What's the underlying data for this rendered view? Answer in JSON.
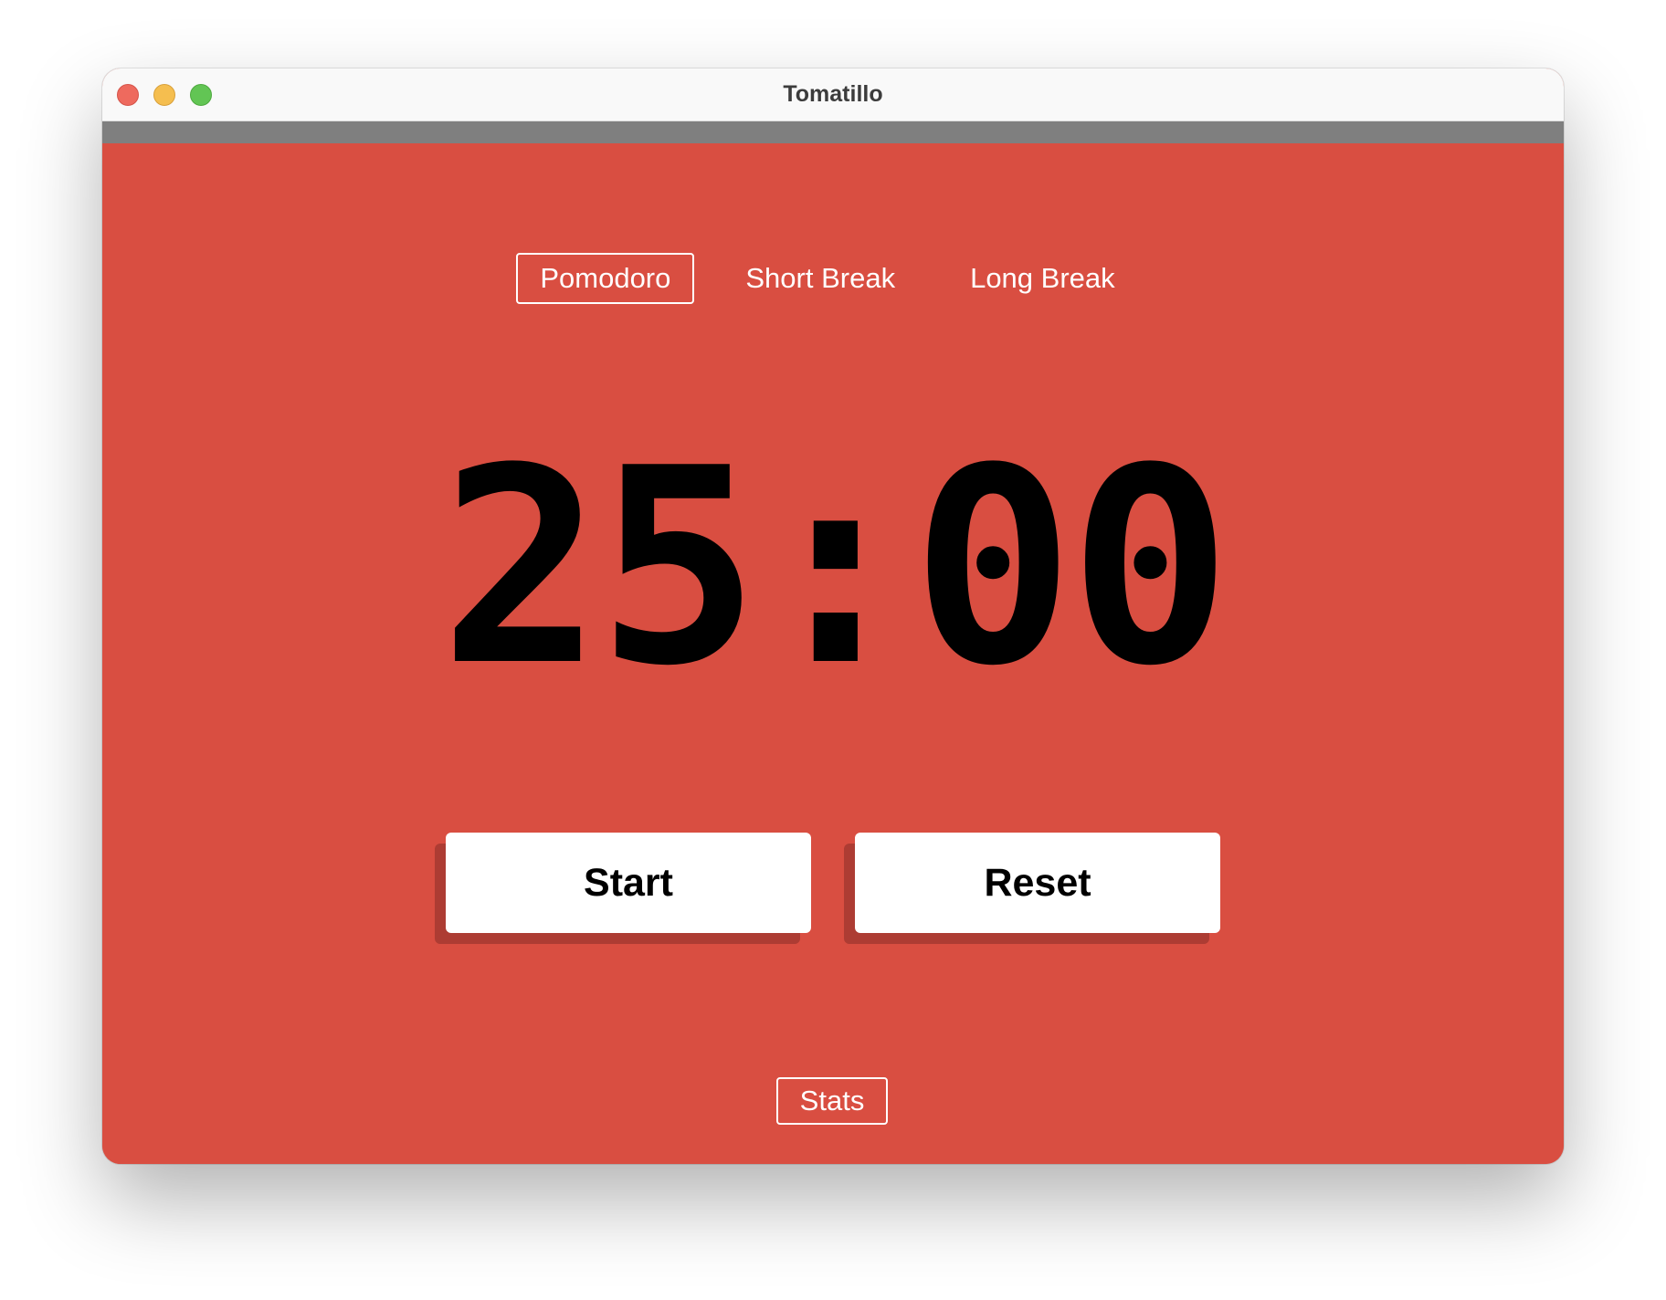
{
  "window": {
    "title": "Tomatillo"
  },
  "modes": [
    {
      "label": "Pomodoro",
      "active": true
    },
    {
      "label": "Short Break",
      "active": false
    },
    {
      "label": "Long Break",
      "active": false
    }
  ],
  "timer": {
    "display": "25:00"
  },
  "controls": {
    "start_label": "Start",
    "reset_label": "Reset"
  },
  "footer": {
    "stats_label": "Stats"
  },
  "colors": {
    "background": "#d94e41",
    "button_shadow": "#ad3c33",
    "toolbar_strip": "#7f7f7f"
  }
}
